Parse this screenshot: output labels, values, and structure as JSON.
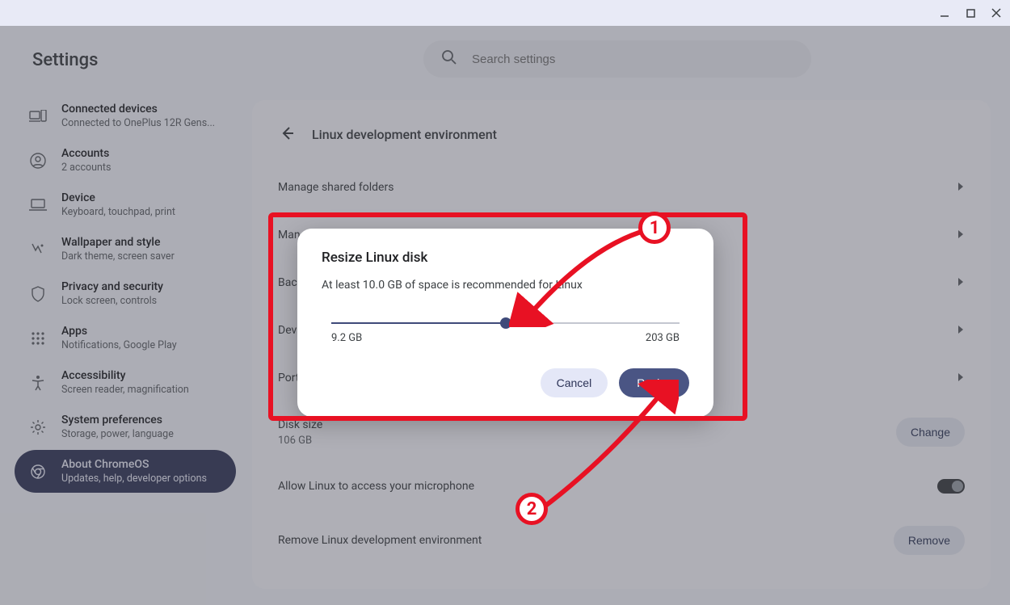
{
  "titlebar": {
    "minimize_icon": "minimize",
    "maximize_icon": "maximize",
    "close_icon": "close"
  },
  "app_title": "Settings",
  "search": {
    "placeholder": "Search settings",
    "icon": "search"
  },
  "sidebar": {
    "items": [
      {
        "icon": "devices",
        "title": "Connected devices",
        "sub": "Connected to OnePlus 12R Gens..."
      },
      {
        "icon": "account",
        "title": "Accounts",
        "sub": "2 accounts"
      },
      {
        "icon": "laptop",
        "title": "Device",
        "sub": "Keyboard, touchpad, print"
      },
      {
        "icon": "wallpaper",
        "title": "Wallpaper and style",
        "sub": "Dark theme, screen saver"
      },
      {
        "icon": "shield",
        "title": "Privacy and security",
        "sub": "Lock screen, controls"
      },
      {
        "icon": "apps",
        "title": "Apps",
        "sub": "Notifications, Google Play"
      },
      {
        "icon": "accessibility",
        "title": "Accessibility",
        "sub": "Screen reader, magnification"
      },
      {
        "icon": "gear",
        "title": "System preferences",
        "sub": "Storage, power, language"
      },
      {
        "icon": "chrome",
        "title": "About ChromeOS",
        "sub": "Updates, help, developer options",
        "active": true
      }
    ]
  },
  "panel": {
    "back_icon": "arrow-back",
    "title": "Linux development environment",
    "rows": [
      {
        "title": "Manage shared folders",
        "type": "chevron"
      },
      {
        "title": "Manage USB devices",
        "type": "chevron"
      },
      {
        "title": "Back",
        "type": "chevron"
      },
      {
        "title": "Dev",
        "type": "chevron"
      },
      {
        "title": "Port",
        "type": "chevron"
      },
      {
        "title": "Disk size",
        "sub": "106 GB",
        "type": "button",
        "button": "Change"
      },
      {
        "title": "Allow Linux to access your microphone",
        "type": "toggle",
        "on": false
      },
      {
        "title": "Remove Linux development environment",
        "type": "button",
        "button": "Remove"
      }
    ]
  },
  "dialog": {
    "title": "Resize Linux disk",
    "desc": "At least 10.0 GB of space is recommended for Linux",
    "min_label": "9.2 GB",
    "max_label": "203 GB",
    "slider_pos_pct": 50,
    "cancel": "Cancel",
    "confirm": "Resize"
  },
  "annotations": {
    "one": "1",
    "two": "2"
  },
  "colors": {
    "accent": "#4a5584",
    "danger": "#e81123"
  }
}
